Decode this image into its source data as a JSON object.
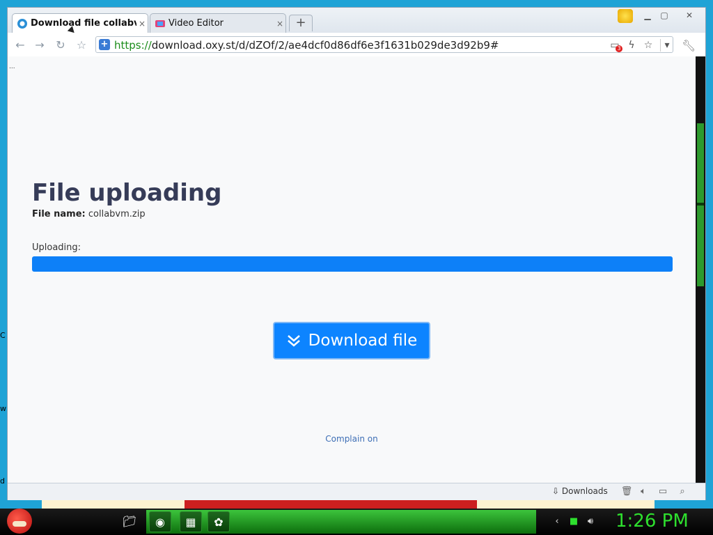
{
  "browser": {
    "tabs": [
      {
        "label": "Download file collabvm.",
        "close": "×",
        "active": true
      },
      {
        "label": "Video Editor",
        "close": "×",
        "active": false
      }
    ],
    "new_tab": "+",
    "url_scheme": "https://",
    "url_rest": "download.oxy.st/d/dZOf/2/ae4dcf0d86df6e3f1631b029de3d92b9#",
    "extension_badge": "3"
  },
  "page": {
    "heading": "File uploading",
    "file_name_label": "File name:",
    "file_name_value": "collabvm.zip",
    "uploading_label": "Uploading:",
    "upload_progress_percent": 100,
    "download_button": "Download file",
    "complain_link": "Complain on",
    "tiny_text": "..."
  },
  "statusbar": {
    "downloads_label": "Downloads"
  },
  "taskbar": {
    "clock": "1:26 PM"
  },
  "desktop": {
    "edge_letters": [
      "C",
      "w",
      "d"
    ]
  },
  "colors": {
    "progress": "#0d80f8",
    "button": "#0d84ff",
    "heading": "#363c58",
    "clock": "#2ee02e"
  }
}
